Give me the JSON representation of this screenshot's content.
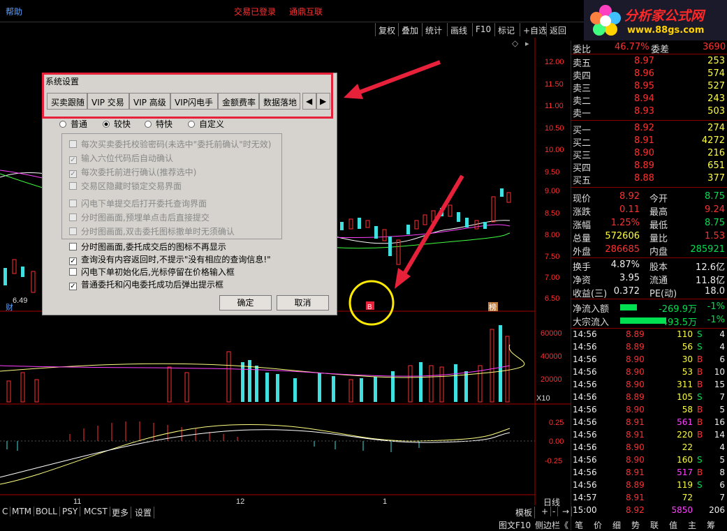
{
  "topbar": {
    "help": "帮助",
    "status1": "交易已登录",
    "status2": "通鼎互联"
  },
  "logo": {
    "title": "分析家公式网",
    "url": "www.88gs.com"
  },
  "toolbar": [
    "复权",
    "叠加",
    "统计",
    "画线",
    "F10",
    "标记",
    "+自选",
    "返回"
  ],
  "price_axis": [
    "12.00",
    "11.50",
    "11.00",
    "10.50",
    "10.00",
    "9.50",
    "9.00",
    "8.50",
    "8.00",
    "7.50",
    "7.00",
    "6.50"
  ],
  "vol_axis": [
    "60000",
    "40000",
    "20000"
  ],
  "vol_unit": "X10",
  "macd_axis": [
    "0.25",
    "0.00",
    "-0.25"
  ],
  "chart_labels": {
    "low": "6.49",
    "cai": "财",
    "bang": "榜",
    "b": "B"
  },
  "date_axis": [
    "11",
    "12",
    "1"
  ],
  "period": "日线",
  "template": "模板",
  "bottom_tabs": [
    "C",
    "MTM",
    "BOLL",
    "PSY",
    "MCST",
    "更多",
    "设置"
  ],
  "bottom_ctrls": [
    "+",
    "-",
    "→"
  ],
  "dialog": {
    "title": "系统设置",
    "tabs": [
      "买卖跟随",
      "VIP 交易",
      "VIP 高级",
      "VIP闪电手",
      "金额费率",
      "数据落地"
    ],
    "radios": [
      {
        "label": "普通",
        "on": false
      },
      {
        "label": "较快",
        "on": true
      },
      {
        "label": "特快",
        "on": false
      },
      {
        "label": "自定义",
        "on": false
      }
    ],
    "group_items": [
      {
        "label": "每次买卖委托校验密码(未选中\"委托前确认\"时无效)",
        "checked": false
      },
      {
        "label": "输入六位代码后自动确认",
        "checked": true
      },
      {
        "label": "每次委托前进行确认(推荐选中)",
        "checked": true
      },
      {
        "label": "交易区隐藏时锁定交易界面",
        "checked": false
      },
      {
        "label": "闪电下单提交后打开委托查询界面",
        "checked": false
      },
      {
        "label": "分时图画面,预埋单点击后直接提交",
        "checked": false
      },
      {
        "label": "分时图画面,双击委托图标撤单时无须确认",
        "checked": false
      }
    ],
    "items": [
      {
        "label": "分时图画面,委托成交后的图标不再显示",
        "checked": false
      },
      {
        "label": "查询没有内容返回时,不提示\"没有相应的查询信息!\"",
        "checked": true
      },
      {
        "label": "闪电下单初始化后,光标停留在价格输入框",
        "checked": false
      },
      {
        "label": "普通委托和闪电委托成功后弹出提示框",
        "checked": true
      }
    ],
    "ok": "确定",
    "cancel": "取消"
  },
  "quote": {
    "weibi": {
      "label": "委比",
      "value": "46.77%",
      "label2": "委差",
      "value2": "3690"
    },
    "sell": [
      {
        "label": "卖五",
        "price": "8.97",
        "vol": "253"
      },
      {
        "label": "卖四",
        "price": "8.96",
        "vol": "574"
      },
      {
        "label": "卖三",
        "price": "8.95",
        "vol": "527"
      },
      {
        "label": "卖二",
        "price": "8.94",
        "vol": "243"
      },
      {
        "label": "卖一",
        "price": "8.93",
        "vol": "503"
      }
    ],
    "buy": [
      {
        "label": "买一",
        "price": "8.92",
        "vol": "274"
      },
      {
        "label": "买二",
        "price": "8.91",
        "vol": "4272"
      },
      {
        "label": "买三",
        "price": "8.90",
        "vol": "216"
      },
      {
        "label": "买四",
        "price": "8.89",
        "vol": "651"
      },
      {
        "label": "买五",
        "price": "8.88",
        "vol": "377"
      }
    ],
    "stats": [
      {
        "l1": "现价",
        "v1": "8.92",
        "c1": "red",
        "l2": "今开",
        "v2": "8.75",
        "c2": "grn"
      },
      {
        "l1": "涨跌",
        "v1": "0.11",
        "c1": "red",
        "l2": "最高",
        "v2": "9.24",
        "c2": "red"
      },
      {
        "l1": "涨幅",
        "v1": "1.25%",
        "c1": "red",
        "l2": "最低",
        "v2": "8.75",
        "c2": "grn"
      },
      {
        "l1": "总量",
        "v1": "572606",
        "c1": "yel",
        "l2": "量比",
        "v2": "1.53",
        "c2": "red"
      },
      {
        "l1": "外盘",
        "v1": "286685",
        "c1": "red",
        "l2": "内盘",
        "v2": "285921",
        "c2": "grn"
      }
    ],
    "stats2": [
      {
        "l1": "换手",
        "v1": "4.87%",
        "l2": "股本",
        "v2": "12.6亿"
      },
      {
        "l1": "净资",
        "v1": "3.95",
        "l2": "流通",
        "v2": "11.8亿"
      },
      {
        "l1": "收益(三)",
        "v1": "0.372",
        "l2": "PE(动)",
        "v2": "18.0"
      }
    ],
    "flow": [
      {
        "label": "净流入额",
        "value": "-269.9万",
        "pct": "-1%"
      },
      {
        "label": "大宗流入",
        "value": "-493.5万",
        "pct": "-1%"
      }
    ]
  },
  "ticks": [
    {
      "t": "14:56",
      "p": "8.89",
      "v": "110",
      "d": "S",
      "n": "4"
    },
    {
      "t": "14:56",
      "p": "8.89",
      "v": "56",
      "d": "S",
      "n": "4"
    },
    {
      "t": "14:56",
      "p": "8.90",
      "v": "30",
      "d": "B",
      "n": "6"
    },
    {
      "t": "14:56",
      "p": "8.90",
      "v": "53",
      "d": "B",
      "n": "10"
    },
    {
      "t": "14:56",
      "p": "8.90",
      "v": "311",
      "d": "B",
      "n": "15"
    },
    {
      "t": "14:56",
      "p": "8.89",
      "v": "105",
      "d": "S",
      "n": "7"
    },
    {
      "t": "14:56",
      "p": "8.90",
      "v": "58",
      "d": "B",
      "n": "5"
    },
    {
      "t": "14:56",
      "p": "8.91",
      "v": "561",
      "d": "B",
      "n": "16"
    },
    {
      "t": "14:56",
      "p": "8.91",
      "v": "220",
      "d": "B",
      "n": "14"
    },
    {
      "t": "14:56",
      "p": "8.90",
      "v": "22",
      "d": "",
      "n": "4"
    },
    {
      "t": "14:56",
      "p": "8.90",
      "v": "160",
      "d": "S",
      "n": "5"
    },
    {
      "t": "14:56",
      "p": "8.91",
      "v": "517",
      "d": "B",
      "n": "8"
    },
    {
      "t": "14:56",
      "p": "8.89",
      "v": "119",
      "d": "S",
      "n": "6"
    },
    {
      "t": "14:57",
      "p": "8.91",
      "v": "72",
      "d": "",
      "n": "7"
    },
    {
      "t": "15:00",
      "p": "8.92",
      "v": "5850",
      "d": "",
      "n": "206"
    }
  ],
  "right_tabs": [
    "笔",
    "价",
    "细",
    "势",
    "联",
    "值",
    "主",
    "筹"
  ],
  "right_footer": [
    "图文F10",
    "侧边栏《"
  ]
}
